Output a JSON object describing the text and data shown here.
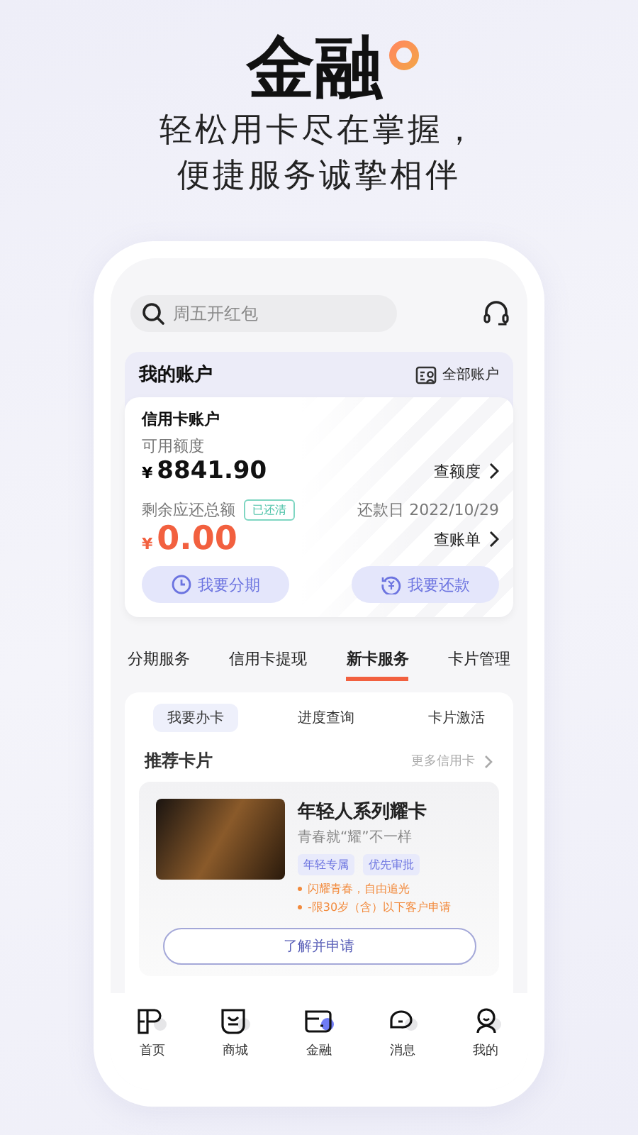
{
  "hero": {
    "title": "金融",
    "subtitle_lines": [
      "轻松用卡尽在掌握，",
      "便捷服务诚挚相伴"
    ]
  },
  "search": {
    "placeholder": "周五开红包"
  },
  "account": {
    "title": "我的账户",
    "all_accounts": "全部账户",
    "card": {
      "title": "信用卡账户",
      "available_label": "可用额度",
      "currency": "¥",
      "available": "8841.90",
      "view_limit": "查额度",
      "due_label": "剩余应还总额",
      "status_badge": "已还清",
      "due_date": "还款日 2022/10/29",
      "due_currency": "¥",
      "due_amount": "0.00",
      "view_bill": "查账单"
    },
    "actions": [
      {
        "label": "我要分期",
        "kind": "clock"
      },
      {
        "label": "我要还款",
        "kind": "repay"
      }
    ]
  },
  "service_tabs": [
    {
      "label": "分期服务",
      "selected": false
    },
    {
      "label": "信用卡提现",
      "selected": false
    },
    {
      "label": "新卡服务",
      "selected": true
    },
    {
      "label": "卡片管理",
      "selected": false
    }
  ],
  "sub_tabs": [
    {
      "label": "我要办卡",
      "selected": true
    },
    {
      "label": "进度查询",
      "selected": false
    },
    {
      "label": "卡片激活",
      "selected": false
    }
  ],
  "recommend": {
    "title": "推荐卡片",
    "more": "更多信用卡",
    "card": {
      "name": "年轻人系列耀卡",
      "slogan": "青春就“耀”不一样",
      "tags": [
        "年轻专属",
        "优先审批"
      ],
      "features": [
        "闪耀青春，自由追光",
        "-限30岁（含）以下客户申请"
      ],
      "apply": "了解并申请"
    }
  },
  "nav": [
    {
      "label": "首页",
      "kind": "home",
      "selected": false
    },
    {
      "label": "商城",
      "kind": "bag",
      "selected": false
    },
    {
      "label": "金融",
      "kind": "wallet",
      "selected": true
    },
    {
      "label": "消息",
      "kind": "chat",
      "selected": false
    },
    {
      "label": "我的",
      "kind": "person",
      "selected": false
    }
  ]
}
